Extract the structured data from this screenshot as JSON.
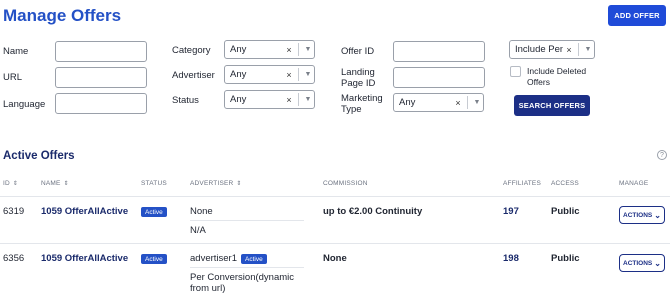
{
  "header": {
    "title": "Manage Offers",
    "add_offer_label": "ADD OFFER"
  },
  "filters": {
    "name_label": "Name",
    "url_label": "URL",
    "language_label": "Language",
    "category_label": "Category",
    "category_value": "Any",
    "advertiser_label": "Advertiser",
    "advertiser_value": "Any",
    "status_label": "Status",
    "status_value": "Any",
    "offer_id_label": "Offer ID",
    "landing_page_id_label": "Landing Page ID",
    "marketing_type_label": "Marketing Type",
    "marketing_type_value": "Any",
    "include_value": "Include Pen...",
    "include_deleted_label": "Include Deleted Offers",
    "search_label": "SEARCH OFFERS"
  },
  "table": {
    "title": "Active Offers",
    "columns": {
      "id": "ID",
      "name": "NAME",
      "status": "STATUS",
      "advertiser": "ADVERTISER",
      "commission": "COMMISSION",
      "affiliates": "AFFILIATES",
      "access": "ACCESS",
      "manage": "MANAGE"
    },
    "rows": [
      {
        "id": "6319",
        "name": "1059 OfferAllActive",
        "status": "Active",
        "advertiser": "None",
        "advertiser_badge": "",
        "advertiser_sub": "N/A",
        "commission": "up to €2.00 Continuity",
        "affiliates": "197",
        "access": "Public",
        "actions": "ACTIONS"
      },
      {
        "id": "6356",
        "name": "1059 OfferAllActive",
        "status": "Active",
        "advertiser": "advertiser1",
        "advertiser_badge": "Active",
        "advertiser_sub": "Per Conversion(dynamic from url)",
        "commission": "None",
        "affiliates": "198",
        "access": "Public",
        "actions": "ACTIONS"
      }
    ]
  },
  "icons": {
    "clear": "×",
    "chevron": "▼",
    "sort": "⇕",
    "help": "?"
  }
}
